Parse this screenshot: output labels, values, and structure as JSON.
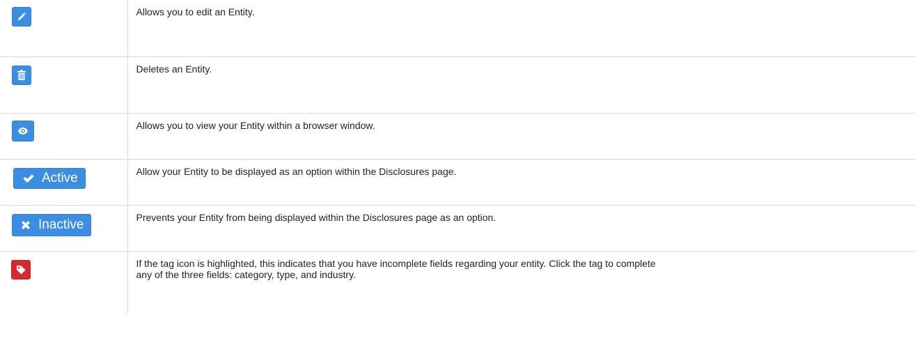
{
  "colors": {
    "button_blue": "#3b8ee3",
    "tag_red": "#d9282f",
    "border": "#d8d8d8",
    "text": "#222222"
  },
  "rows": [
    {
      "icon": "pencil-icon",
      "description": "Allows you to edit an Entity."
    },
    {
      "icon": "trash-icon",
      "description": "Deletes an Entity."
    },
    {
      "icon": "eye-icon",
      "description": "Allows you to view your Entity within a browser window."
    },
    {
      "icon": "checkmark-icon",
      "button_label": "Active",
      "description": "Allow your Entity to be displayed as an option within the Disclosures page."
    },
    {
      "icon": "x-icon",
      "button_label": "Inactive",
      "description": "Prevents your Entity from being displayed within the Disclosures page as an option."
    },
    {
      "icon": "tag-icon",
      "description_line1": "If the tag icon is highlighted, this indicates that you have incomplete fields regarding your entity. Click the tag to complete",
      "description_line2": "any of the three fields: category, type, and industry."
    }
  ]
}
